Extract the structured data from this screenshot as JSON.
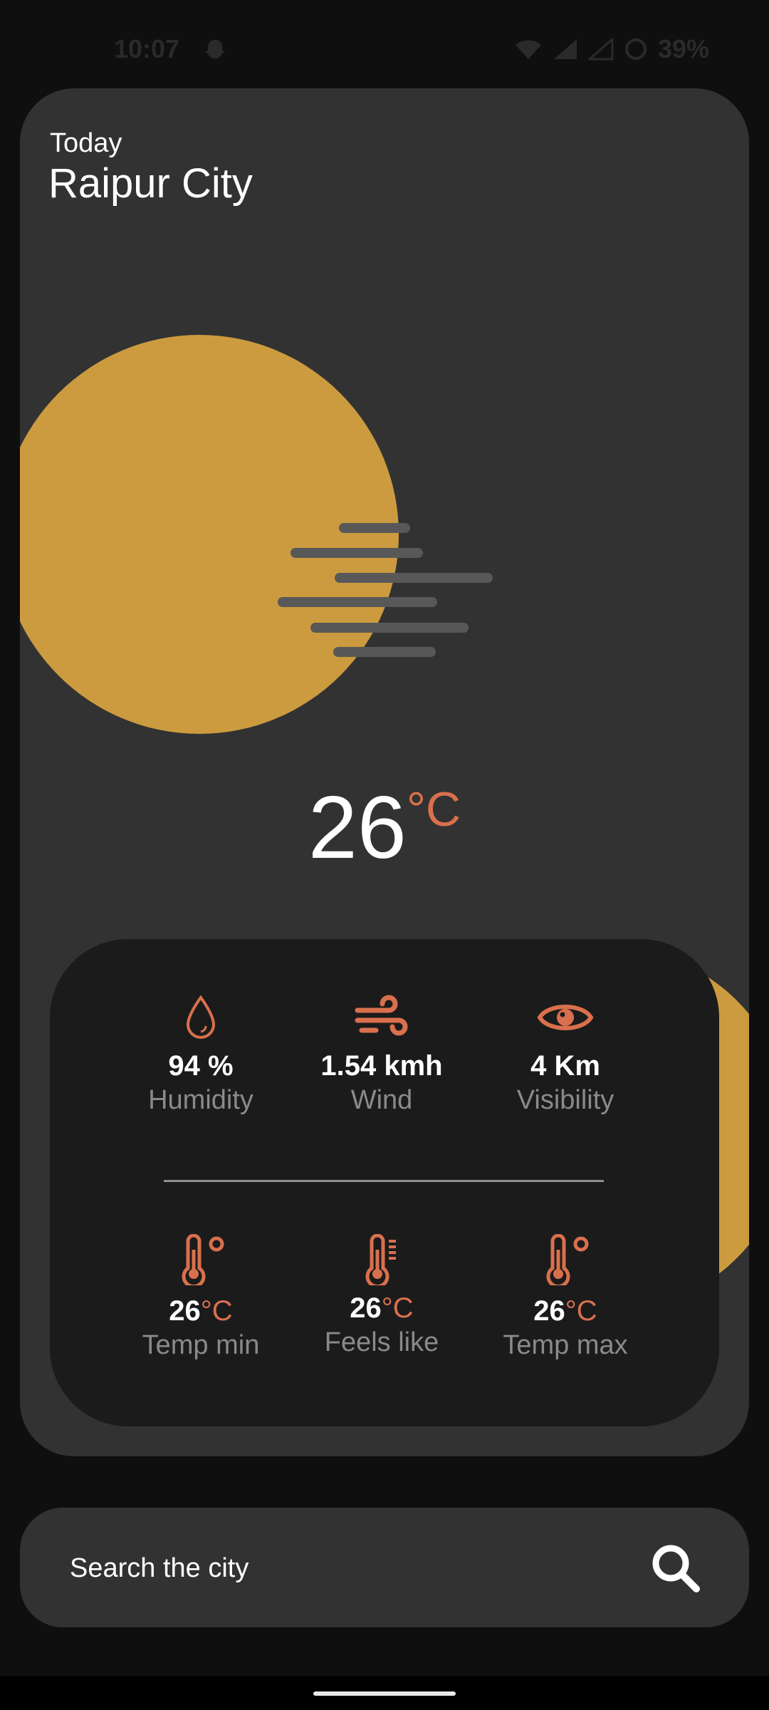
{
  "status_bar": {
    "time": "10:07",
    "battery": "39%"
  },
  "weather": {
    "day_label": "Today",
    "city": "Raipur City",
    "temperature": "26",
    "unit": "°C"
  },
  "stats": {
    "humidity": {
      "value": "94 %",
      "label": "Humidity"
    },
    "wind": {
      "value": "1.54 kmh",
      "label": "Wind"
    },
    "visibility": {
      "value": "4 Km",
      "label": "Visibility"
    },
    "temp_min": {
      "value": "26",
      "unit": "°C",
      "label": "Temp min"
    },
    "feels_like": {
      "value": "26",
      "unit": "°C",
      "label": "Feels like"
    },
    "temp_max": {
      "value": "26",
      "unit": "°C",
      "label": "Temp max"
    }
  },
  "search": {
    "placeholder": "Search the city"
  },
  "colors": {
    "accent": "#d9704d",
    "sun": "#cc9b40",
    "card": "#323232",
    "stats_card": "#1b1b1b"
  }
}
